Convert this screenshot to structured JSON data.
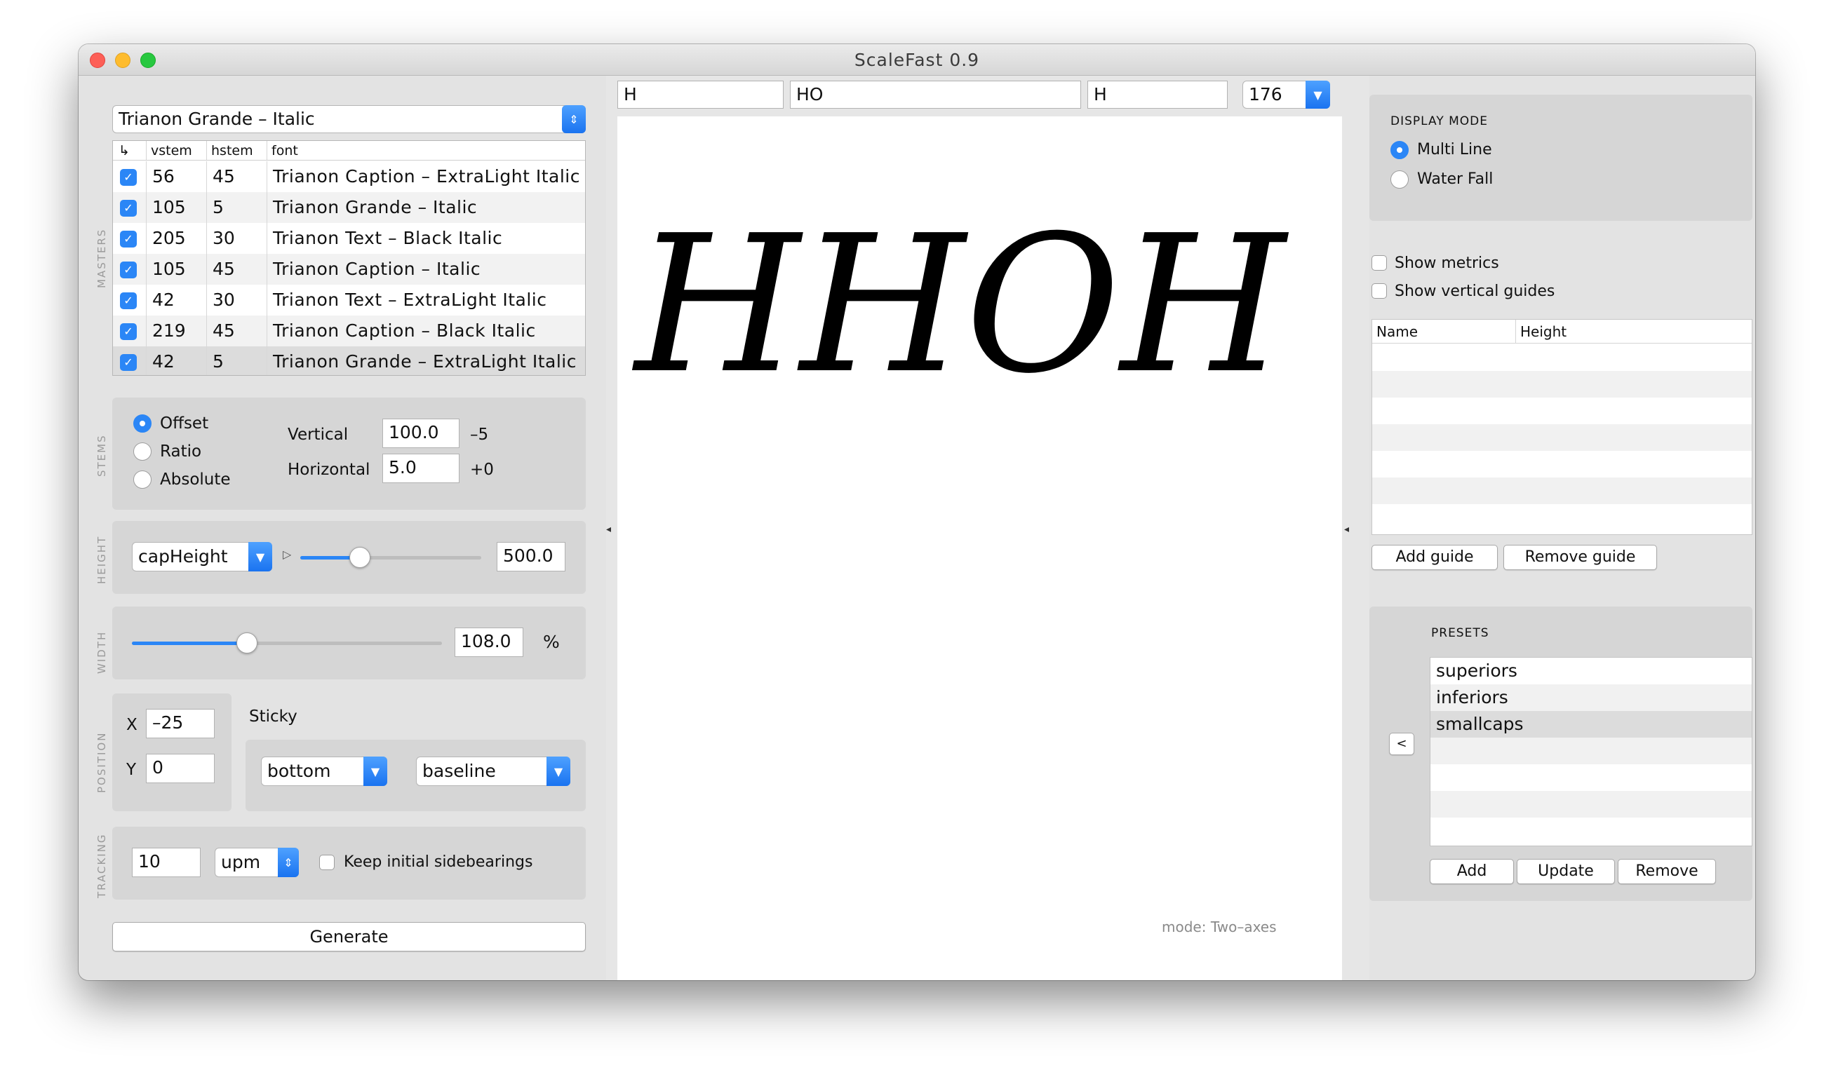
{
  "window": {
    "title": "ScaleFast 0.9"
  },
  "left": {
    "font_select": "Trianon Grande – Italic",
    "masters": {
      "section_label": "MASTERS",
      "headers": {
        "arrow": "↳",
        "vstem": "vstem",
        "hstem": "hstem",
        "font": "font"
      },
      "rows": [
        {
          "checked": true,
          "vstem": "56",
          "hstem": "45",
          "font": "Trianon Caption – ExtraLight Italic"
        },
        {
          "checked": true,
          "vstem": "105",
          "hstem": "5",
          "font": "Trianon Grande – Italic"
        },
        {
          "checked": true,
          "vstem": "205",
          "hstem": "30",
          "font": "Trianon Text – Black Italic"
        },
        {
          "checked": true,
          "vstem": "105",
          "hstem": "45",
          "font": "Trianon Caption – Italic"
        },
        {
          "checked": true,
          "vstem": "42",
          "hstem": "30",
          "font": "Trianon Text – ExtraLight Italic"
        },
        {
          "checked": true,
          "vstem": "219",
          "hstem": "45",
          "font": "Trianon Caption – Black Italic"
        },
        {
          "checked": true,
          "vstem": "42",
          "hstem": "5",
          "font": "Trianon Grande – ExtraLight Italic"
        }
      ]
    },
    "stems": {
      "section_label": "STEMS",
      "modes": [
        "Offset",
        "Ratio",
        "Absolute"
      ],
      "selected_mode": "Offset",
      "vertical_label": "Vertical",
      "vertical_value": "100.0",
      "vertical_delta": "–5",
      "horizontal_label": "Horizontal",
      "horizontal_value": "5.0",
      "horizontal_delta": "+0"
    },
    "height": {
      "section_label": "HEIGHT",
      "metric": "capHeight",
      "toggle": "▷",
      "value": "500.0",
      "slider_fraction": 0.33
    },
    "width": {
      "section_label": "WIDTH",
      "value": "108.0",
      "unit": "%",
      "slider_fraction": 0.37
    },
    "position": {
      "section_label": "POSITION",
      "x_label": "X",
      "x_value": "–25",
      "y_label": "Y",
      "y_value": "0",
      "sticky_label": "Sticky",
      "sticky_vertical": "bottom",
      "sticky_reference": "baseline"
    },
    "tracking": {
      "section_label": "TRACKING",
      "value": "10",
      "unit": "upm",
      "keep_label": "Keep initial sidebearings",
      "keep_checked": false
    },
    "generate_label": "Generate"
  },
  "center": {
    "input_1": "H",
    "input_2": "HO",
    "input_3": "H",
    "size_value": "176",
    "preview_text": "HHOH",
    "mode_status": "mode: Two–axes"
  },
  "right": {
    "display_mode": {
      "title": "DISPLAY MODE",
      "options": [
        "Multi Line",
        "Water Fall"
      ],
      "selected": "Multi Line"
    },
    "show_metrics": "Show metrics",
    "show_vertical_guides": "Show vertical guides",
    "guides_headers": {
      "name": "Name",
      "height": "Height"
    },
    "add_guide": "Add guide",
    "remove_guide": "Remove guide",
    "presets": {
      "title": "PRESETS",
      "items": [
        "superiors",
        "inferiors",
        "smallcaps"
      ],
      "selected": "smallcaps",
      "collapse": "<",
      "add": "Add",
      "update": "Update",
      "remove": "Remove"
    }
  },
  "colors": {
    "accent": "#2b86f6",
    "panel": "#d6d6d6",
    "background": "#e3e3e3"
  }
}
